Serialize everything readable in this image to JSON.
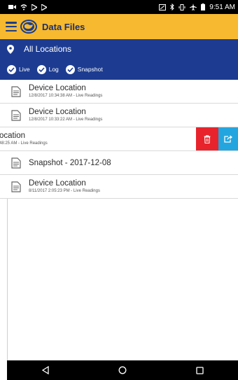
{
  "status_bar": {
    "time": "9:51 AM"
  },
  "app_bar": {
    "title": "Data Files"
  },
  "filter": {
    "location_label": "All Locations",
    "toggles": [
      {
        "label": "Live",
        "checked": true
      },
      {
        "label": "Log",
        "checked": true
      },
      {
        "label": "Snapshot",
        "checked": true
      }
    ]
  },
  "files": [
    {
      "title": "Device Location",
      "subtitle": "12/8/2017 10:34:38 AM - Live Readings"
    },
    {
      "title": "Device Location",
      "subtitle": "12/8/2017 10:33:22 AM - Live Readings"
    },
    {
      "title": "ocation",
      "subtitle": "48:25 AM - Live Readings"
    },
    {
      "title": "Snapshot - 2017-12-08"
    },
    {
      "title": "Device Location",
      "subtitle": "8/11/2017 2:05:23 PM - Live Readings"
    }
  ],
  "colors": {
    "app_bar": "#f6b92f",
    "filter_panel": "#1d3c91",
    "delete": "#e8232b",
    "share": "#23a6e0"
  },
  "icons": {
    "menu": "hamburger-icon",
    "logo": "globe-logo",
    "location": "map-pin-icon",
    "check": "check-circle-icon",
    "file": "document-icon",
    "delete": "trash-icon",
    "share": "share-icon",
    "nav_back": "back-triangle-icon",
    "nav_home": "home-circle-icon",
    "nav_recents": "recents-square-icon"
  }
}
